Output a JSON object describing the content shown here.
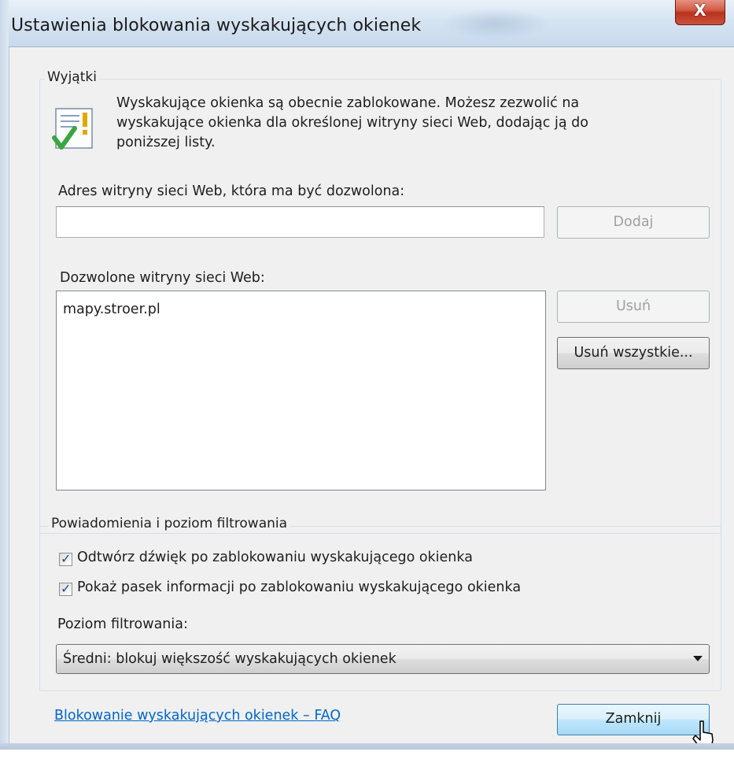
{
  "window": {
    "title": "Ustawienia blokowania wyskakujących okienek",
    "close_label": "X"
  },
  "exceptions": {
    "group_label": "Wyjątki",
    "icon": "info-checklist-icon",
    "info_line1": "Wyskakujące okienka są obecnie zablokowane. Możesz zezwolić na",
    "info_line2": "wyskakujące okienka dla określonej witryny sieci Web, dodając ją do",
    "info_line3": "poniższej listy.",
    "address_label": "Adres witryny sieci Web, która ma być dozwolona:",
    "address_value": "",
    "add_button": "Dodaj",
    "allowed_label": "Dozwolone witryny sieci Web:",
    "allowed_sites": [
      "mapy.stroer.pl"
    ],
    "remove_button": "Usuń",
    "remove_all_button": "Usuń wszystkie..."
  },
  "notifications": {
    "group_label": "Powiadomienia i poziom filtrowania",
    "play_sound_label": "Odtwórz dźwięk po zablokowaniu wyskakującego okienka",
    "play_sound_checked": true,
    "show_infobar_label": "Pokaż pasek informacji po zablokowaniu wyskakującego okienka",
    "show_infobar_checked": true,
    "filter_level_label": "Poziom filtrowania:",
    "filter_level_value": "Średni: blokuj większość wyskakujących okienek"
  },
  "footer": {
    "faq_link": "Blokowanie wyskakujących okienek – FAQ",
    "close_button": "Zamknij"
  },
  "colors": {
    "link": "#0066cc",
    "close_button_red": "#c9523a",
    "dialog_background": "#f0f0f0"
  }
}
